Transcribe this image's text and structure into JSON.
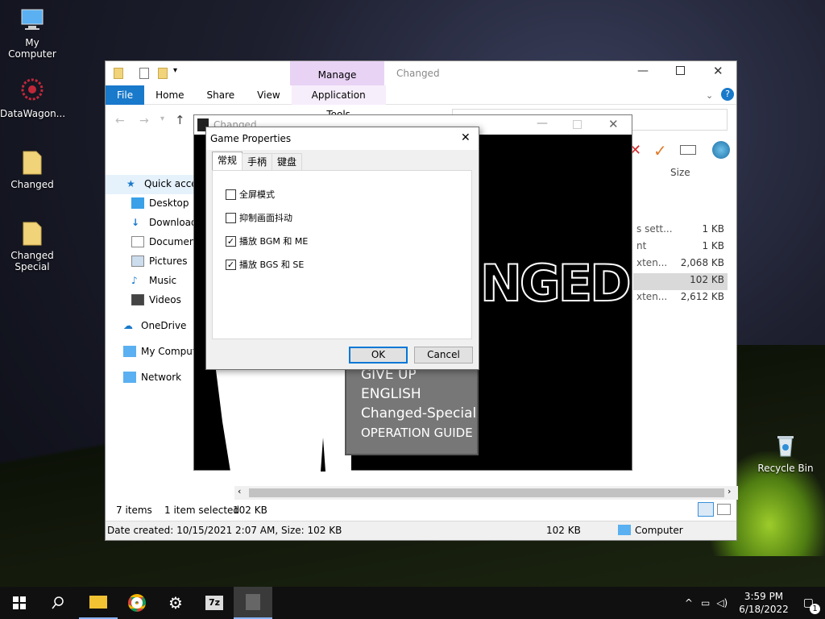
{
  "desktop": {
    "icons": [
      {
        "label": "My Computer",
        "icon": "computer-icon"
      },
      {
        "label": "DataWagon...",
        "icon": "datawagon-icon"
      },
      {
        "label": "Changed",
        "icon": "folder-icon"
      },
      {
        "label": "Changed Special",
        "icon": "folder-icon"
      },
      {
        "label": "Recycle Bin",
        "icon": "recycle-bin-icon"
      }
    ]
  },
  "explorer": {
    "title": "Changed",
    "manage_label": "Manage",
    "tabs": [
      "File",
      "Home",
      "Share",
      "View",
      "Application Tools"
    ],
    "sidebar": [
      "Quick access",
      "Desktop",
      "Downloads",
      "Documents",
      "Pictures",
      "Music",
      "Videos",
      "OneDrive",
      "My Computer",
      "Network"
    ],
    "column_size": "Size",
    "rows": [
      {
        "name_tail": "s sett...",
        "size": "1 KB"
      },
      {
        "name_tail": "nt",
        "size": "1 KB"
      },
      {
        "name_tail": "xten...",
        "size": "2,068 KB"
      },
      {
        "name_tail": "",
        "size": "102 KB"
      },
      {
        "name_tail": "xten...",
        "size": "2,612 KB"
      }
    ],
    "status_items": "7 items",
    "status_selected": "1 item selected",
    "status_selected_size": "102 KB",
    "details_bar": "Date created: 10/15/2021 2:07 AM, Size: 102 KB",
    "details_size": "102 KB",
    "details_location": "Computer"
  },
  "game": {
    "title": "Changed",
    "logo_text": "NGED",
    "menu": [
      "GIVE UP",
      "ENGLISH",
      "Changed-Special",
      "OPERATION GUIDE"
    ]
  },
  "dialog": {
    "title": "Game Properties",
    "tabs": [
      "常规",
      "手柄",
      "键盘"
    ],
    "options": [
      {
        "label": "全屏模式",
        "checked": false
      },
      {
        "label": "抑制画面抖动",
        "checked": false
      },
      {
        "label": "播放 BGM 和 ME",
        "checked": true
      },
      {
        "label": "播放 BGS 和 SE",
        "checked": true
      }
    ],
    "ok": "OK",
    "cancel": "Cancel",
    "close": "✕"
  },
  "taskbar": {
    "time": "3:59 PM",
    "date": "6/18/2022",
    "notification_count": "1"
  },
  "colors": {
    "ribbon_accent": "#1979ca",
    "manage_bg": "#e8d3f5",
    "default_button_border": "#0078d7"
  }
}
